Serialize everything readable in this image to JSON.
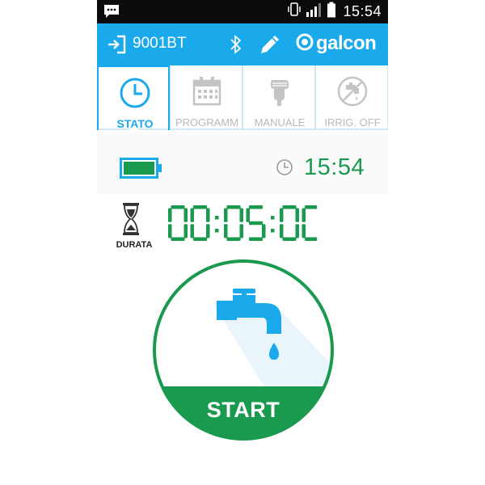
{
  "status_bar": {
    "time": "15:54",
    "icons": [
      "notification-icon",
      "vibrate-icon",
      "signal-icon",
      "battery-icon"
    ]
  },
  "header": {
    "device_name": "9001BT",
    "brand": "galcon",
    "icons": [
      "exit-icon",
      "bluetooth-icon",
      "edit-icon",
      "galcon-logo"
    ]
  },
  "tabs": [
    {
      "label": "STATO",
      "icon": "clock-icon",
      "active": true
    },
    {
      "label": "PROGRAMM",
      "icon": "calendar-icon",
      "active": false
    },
    {
      "label": "MANUALE",
      "icon": "hand-icon",
      "active": false
    },
    {
      "label": "IRRIG. OFF",
      "icon": "no-watering-icon",
      "active": false
    }
  ],
  "status": {
    "time": "15:54",
    "battery_level": 1.0
  },
  "duration": {
    "label": "DURATA",
    "time": "00:05:00"
  },
  "start": {
    "label": "START"
  },
  "colors": {
    "primary_blue": "#1aa9ea",
    "green": "#1a9a4f",
    "inactive_gray": "#b9b9b9"
  }
}
